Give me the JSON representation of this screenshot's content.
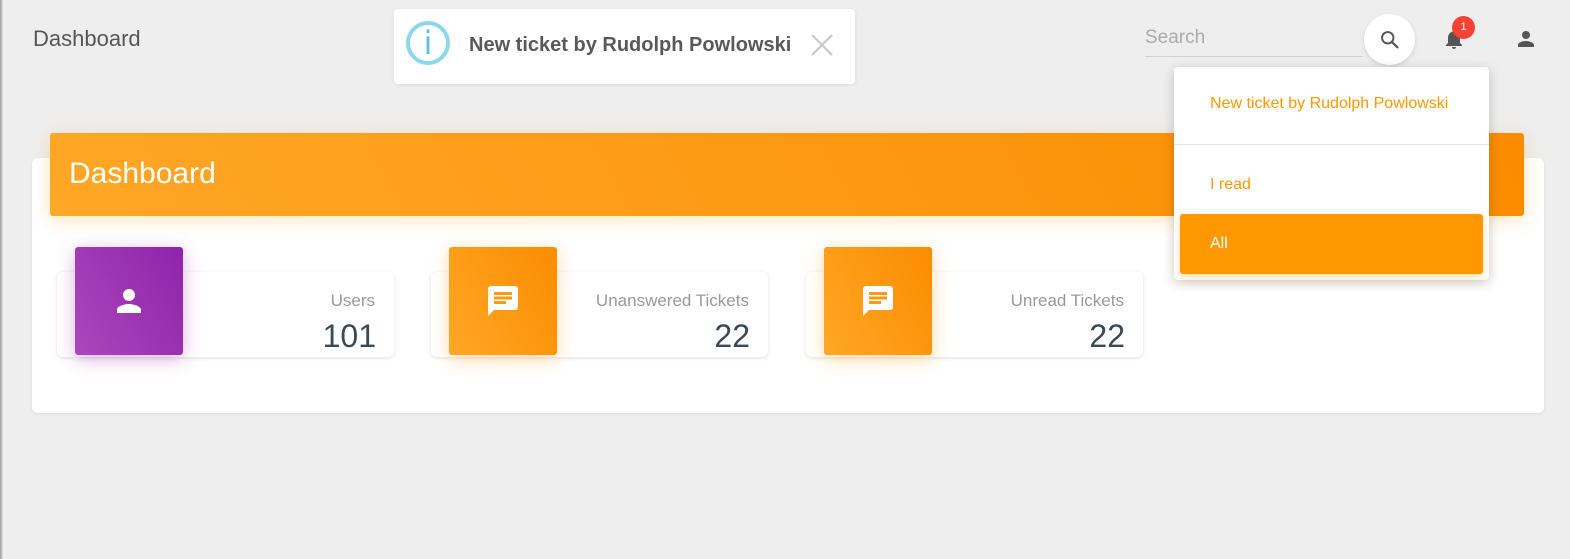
{
  "navbar": {
    "brand": "Dashboard",
    "search_placeholder": "Search",
    "notification_count": "1"
  },
  "toast": {
    "message": "New ticket by Rudolph Powlowski",
    "icon": "i"
  },
  "dropdown": {
    "items": [
      {
        "label": "New ticket by Rudolph Powlowski"
      },
      {
        "label": "I read"
      },
      {
        "label": "All",
        "active": true
      }
    ]
  },
  "card": {
    "title": "Dashboard"
  },
  "stats": [
    {
      "label": "Users",
      "value": "101",
      "icon": "person-icon",
      "color": "#9c27b0"
    },
    {
      "label": "Unanswered Tickets",
      "value": "22",
      "icon": "chat-icon",
      "color": "#ff9800"
    },
    {
      "label": "Unread Tickets",
      "value": "22",
      "icon": "chat-icon",
      "color": "#ff9800"
    }
  ],
  "colors": {
    "accent": "#ff9800",
    "purple": "#9c27b0",
    "badge": "#f44336",
    "info": "#5bc2e6"
  }
}
